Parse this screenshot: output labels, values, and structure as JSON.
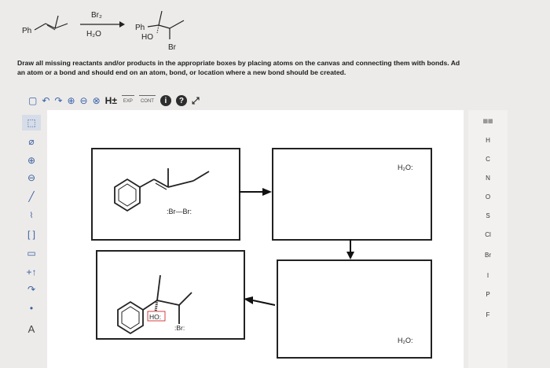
{
  "reaction": {
    "reactant_label": "Ph",
    "reagent_top": "Br₂",
    "reagent_bottom": "H₂O",
    "product_ph": "Ph",
    "product_ho": "HO",
    "product_br": "Br"
  },
  "instructions": {
    "line1": "Draw all missing reactants and/or products in the appropriate boxes by placing atoms on the canvas and connecting them with bonds. Ad",
    "line2": "an atom or a bond and should end on an atom, bond, or location where a new bond should be created."
  },
  "toolbar": {
    "h_label": "H±",
    "exp_label": "EXP",
    "cont_label": "CONT"
  },
  "boxes": {
    "box1_reagent": ":Br—Br:",
    "box2_reagent": "H₂O:",
    "box3_reagent": "H₂O:",
    "box4_ho": "HO:",
    "box4_br": ":Br:"
  },
  "elements": [
    "H",
    "C",
    "N",
    "O",
    "S",
    "Cl",
    "Br",
    "I",
    "P",
    "F"
  ],
  "left_tools": [
    "select",
    "eraser",
    "plus-charge",
    "minus-charge",
    "bond",
    "chain",
    "ring-template",
    "rectangle",
    "arrow",
    "electron-pushing",
    "lone-pair",
    "atom-label"
  ],
  "atom_label_tool": "A",
  "colors": {
    "toolbar_icon": "#3a63a8",
    "arrow": "#111111"
  }
}
